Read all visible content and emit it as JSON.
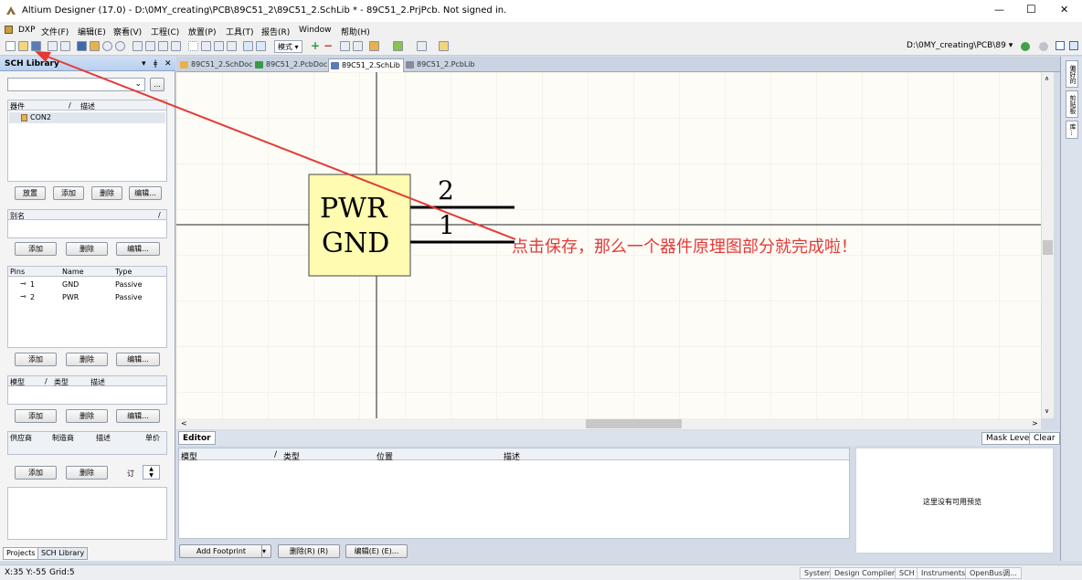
{
  "window": {
    "title": "Altium Designer (17.0) - D:\\0MY_creating\\PCB\\89C51_2\\89C51_2.SchLib * - 89C51_2.PrjPcb. Not signed in.",
    "minimize": "—",
    "maximize": "☐",
    "close": "✕"
  },
  "menu": {
    "items": [
      "DXP",
      "文件(F)",
      "编辑(E)",
      "察看(V)",
      "工程(C)",
      "放置(P)",
      "工具(T)",
      "报告(R)",
      "Window",
      "帮助(H)"
    ]
  },
  "toolbar": {
    "mode_label": "模式 ▾",
    "path": "D:\\0MY_creating\\PCB\\89 ▾"
  },
  "sch_library": {
    "title": "SCH Library",
    "panel_controls": [
      "▾",
      "ǂ",
      "✕"
    ],
    "browse_button": "...",
    "components_header": [
      "器件",
      "/",
      "描述"
    ],
    "components": [
      "CON2"
    ],
    "comp_buttons": [
      "放置",
      "添加",
      "删除",
      "编辑..."
    ],
    "aliases_header": [
      "别名",
      "/"
    ],
    "alias_buttons": [
      "添加",
      "删除",
      "编辑..."
    ],
    "pins_header": [
      "Pins",
      "Name",
      "Type"
    ],
    "pins": [
      {
        "num": "1",
        "name": "GND",
        "type": "Passive"
      },
      {
        "num": "2",
        "name": "PWR",
        "type": "Passive"
      }
    ],
    "pin_buttons": [
      "添加",
      "删除",
      "编辑..."
    ],
    "models_header": [
      "模型",
      "/",
      "类型",
      "描述"
    ],
    "model_buttons": [
      "添加",
      "删除",
      "编辑..."
    ],
    "supplier_header": [
      "供应商",
      "制造商",
      "描述",
      "单价"
    ],
    "supplier_buttons": [
      "添加",
      "删除",
      "订"
    ],
    "bottom_tabs": [
      "Projects",
      "SCH Library"
    ]
  },
  "doc_tabs": [
    {
      "label": "89C51_2.SchDoc",
      "color": "#e8b24a"
    },
    {
      "label": "89C51_2.PcbDoc",
      "color": "#3a9a4a"
    },
    {
      "label": "89C51_2.SchLib *",
      "color": "#5a7ab8"
    },
    {
      "label": "89C51_2.PcbLib",
      "color": "#8a8a9a"
    }
  ],
  "schematic": {
    "body_text_top": "PWR",
    "body_text_bottom": "GND",
    "pin_num_top": "2",
    "pin_num_bottom": "1",
    "annotation": "点击保存，那么一个器件原理图部分就完成啦！",
    "body_fill": "#fffbb0",
    "annotation_color": "#e53935"
  },
  "right_tabs": [
    "偏好的",
    "剪贴板",
    "库..."
  ],
  "editor": {
    "tab_label": "Editor",
    "mask_level": "Mask Level",
    "clear": "Clear",
    "columns": [
      "模型",
      "/",
      "类型",
      "位置",
      "描述"
    ],
    "preview_text": "这里没有可用预览",
    "buttons": [
      "Add Footprint",
      "删除(R) (R)",
      "编辑(E) (E)..."
    ]
  },
  "status": {
    "coords": "X:35 Y:-55",
    "grid": "Grid:5",
    "tabs": [
      "System",
      "Design Compiler",
      "SCH",
      "Instruments",
      "OpenBus调..."
    ]
  }
}
